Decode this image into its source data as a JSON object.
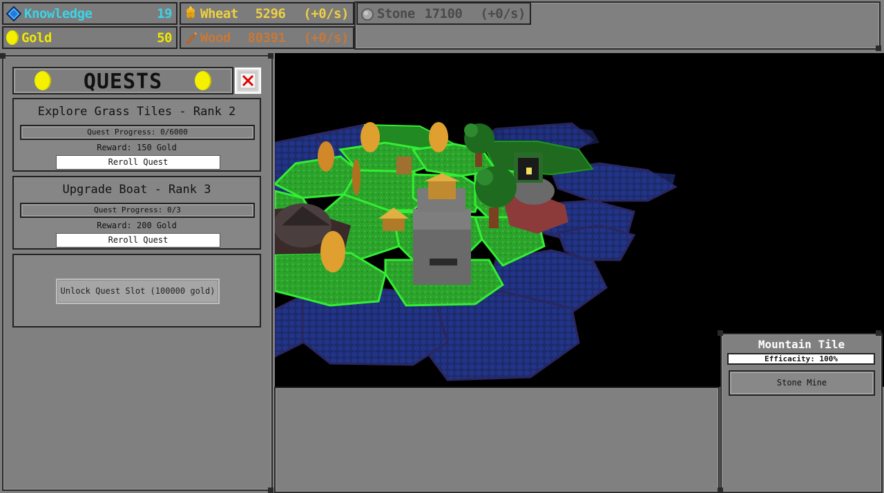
{
  "resources": {
    "knowledge": {
      "label": "Knowledge",
      "value": "19",
      "color": "#3ad4e8"
    },
    "gold": {
      "label": "Gold",
      "value": "50",
      "color": "#f0e800"
    },
    "wheat": {
      "label": "Wheat",
      "value": "5296",
      "rate": "(+0/s)",
      "color": "#f0d040"
    },
    "wood": {
      "label": "Wood",
      "value": "80391",
      "rate": "(+0/s)",
      "color": "#c87838"
    },
    "stone": {
      "label": "Stone",
      "value": "17100",
      "rate": "(+0/s)",
      "color": "#4a4a4a"
    }
  },
  "quests": {
    "title": "QUESTS",
    "items": [
      {
        "title": "Explore Grass Tiles - Rank 2",
        "progress": "Quest Progress: 0/6000",
        "reward": "Reward: 150 Gold",
        "reroll_label": "Reroll Quest"
      },
      {
        "title": "Upgrade Boat - Rank 3",
        "progress": "Quest Progress: 0/3",
        "reward": "Reward: 200 Gold",
        "reroll_label": "Reroll Quest"
      }
    ],
    "unlock_label": "Unlock Quest Slot (100000 gold)"
  },
  "tile_info": {
    "title": "Mountain Tile",
    "efficacity": "Efficacity: 100%",
    "building": "Stone Mine"
  },
  "icons": {
    "knowledge": "diamond-icon",
    "gold": "coin-icon",
    "wheat": "wheat-icon",
    "wood": "log-icon",
    "stone": "stone-icon",
    "close": "close-icon"
  },
  "colors": {
    "panel": "#808080",
    "border": "#2a2a2a",
    "grass": "#2ea82e",
    "grass_edge": "#33ee33",
    "water": "#1e2a66",
    "close_x": "#e00000"
  }
}
